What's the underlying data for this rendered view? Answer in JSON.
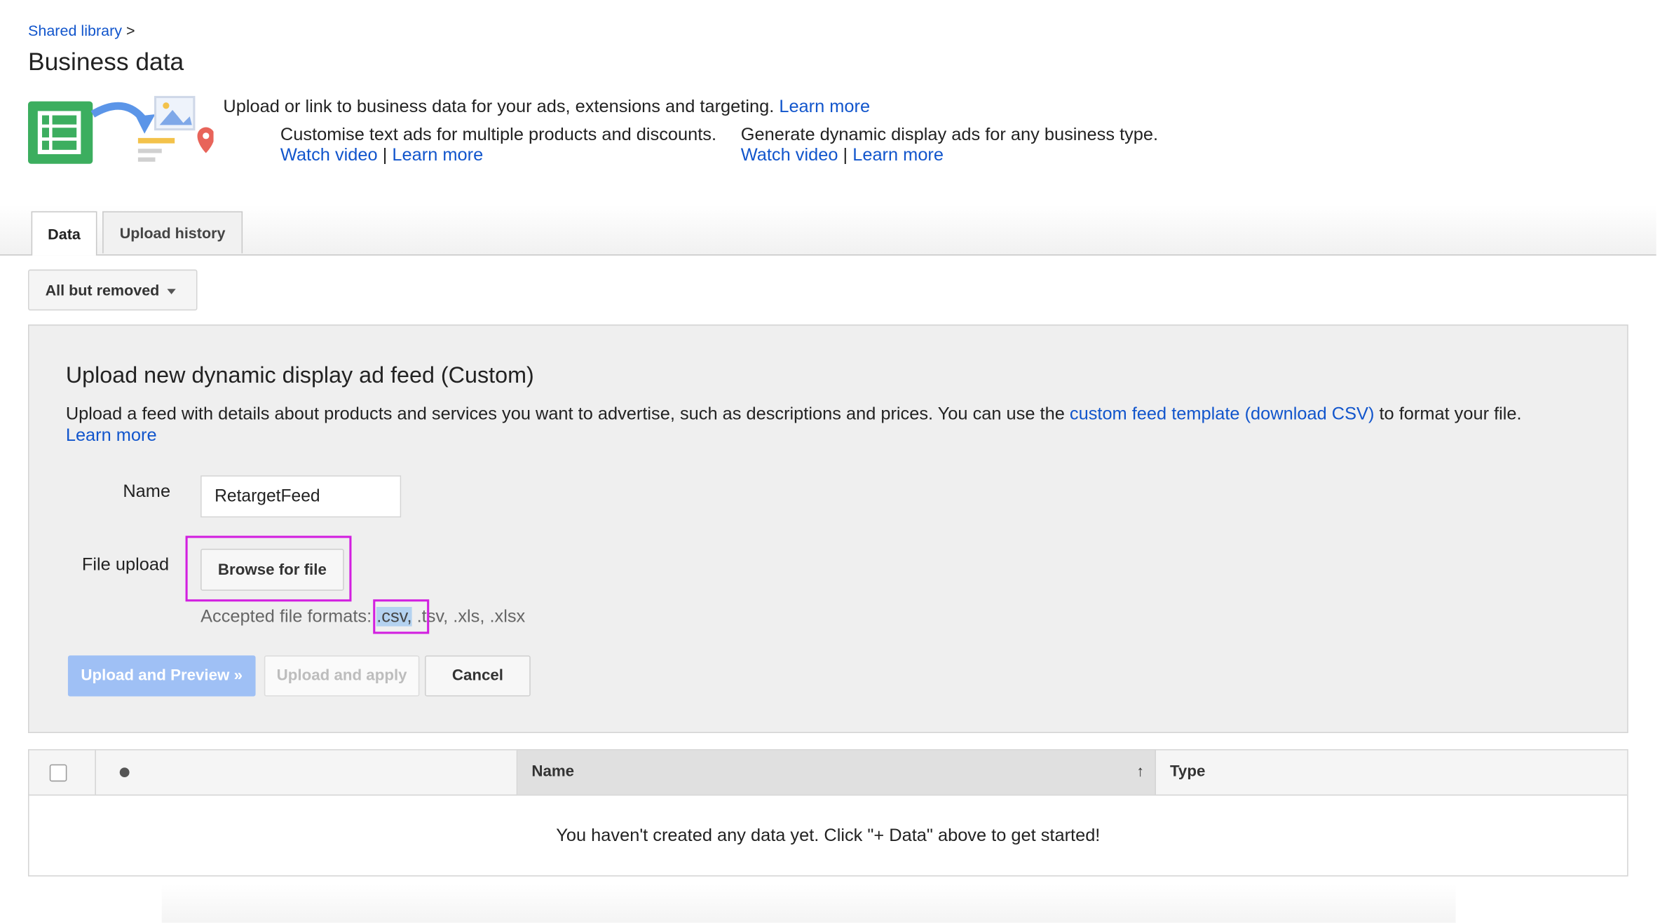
{
  "breadcrumb": {
    "link": "Shared library",
    "sep": ">"
  },
  "page_title": "Business data",
  "intro": {
    "text": "Upload or link to business data for your ads, extensions and targeting.",
    "link": "Learn more"
  },
  "features": [
    {
      "text": "Customise text ads for multiple products and discounts.",
      "video": "Watch video",
      "sep": "|",
      "learn": "Learn more"
    },
    {
      "text": "Generate dynamic display ads for any business type.",
      "video": "Watch video",
      "sep": "|",
      "learn": "Learn more"
    }
  ],
  "tabs": [
    {
      "label": "Data",
      "active": true
    },
    {
      "label": "Upload history",
      "active": false
    }
  ],
  "filter": {
    "label": "All but removed"
  },
  "panel": {
    "title": "Upload new dynamic display ad feed (Custom)",
    "desc_before": "Upload a feed with details about products and services you want to advertise, such as descriptions and prices. You can use the",
    "desc_link": "custom feed template (download CSV)",
    "desc_after": "to format your file.",
    "learn_more": "Learn more",
    "name_label": "Name",
    "name_value": "RetargetFeed",
    "file_label": "File upload",
    "browse_label": "Browse for file",
    "formats_before": "Accepted file formats:",
    "formats_csv": ".csv,",
    "formats_after": ".tsv, .xls, .xlsx",
    "btn_preview": "Upload and Preview »",
    "btn_apply": "Upload and apply",
    "btn_cancel": "Cancel"
  },
  "table": {
    "col_name": "Name",
    "col_type": "Type",
    "sort_icon": "↑",
    "empty": "You haven't created any data yet. Click \"+ Data\" above to get started!"
  },
  "colors": {
    "link": "#1155cc",
    "highlight": "#d21fe0",
    "primary_disabled": "#9fc0f5"
  }
}
